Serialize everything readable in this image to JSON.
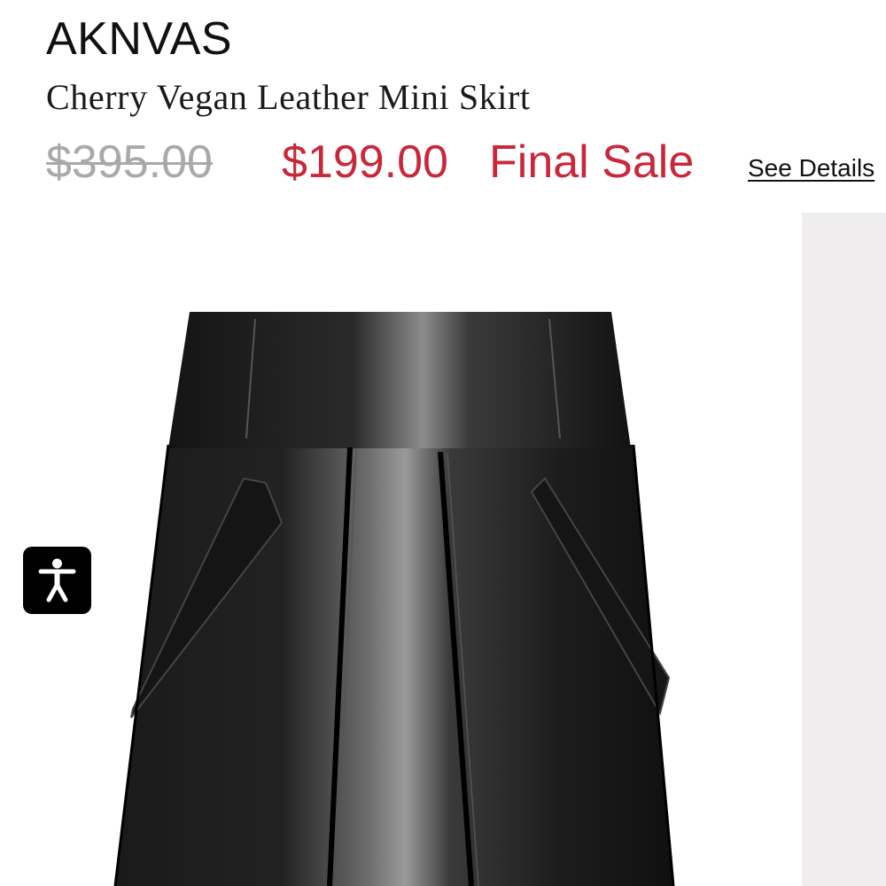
{
  "product": {
    "brand": "AKNVAS",
    "name": "Cherry Vegan Leather Mini Skirt",
    "original_price": "$395.00",
    "sale_price": "$199.00",
    "sale_label": "Final Sale",
    "details_link": "See Details"
  },
  "gallery": {
    "image_subject": "black vegan leather mini skirt",
    "side_panel_color": "#efedee"
  },
  "accessibility": {
    "icon": "accessibility-person-icon"
  },
  "colors": {
    "sale_red": "#c8283a",
    "strikethrough_gray": "#a9a9a9",
    "text": "#111111"
  }
}
